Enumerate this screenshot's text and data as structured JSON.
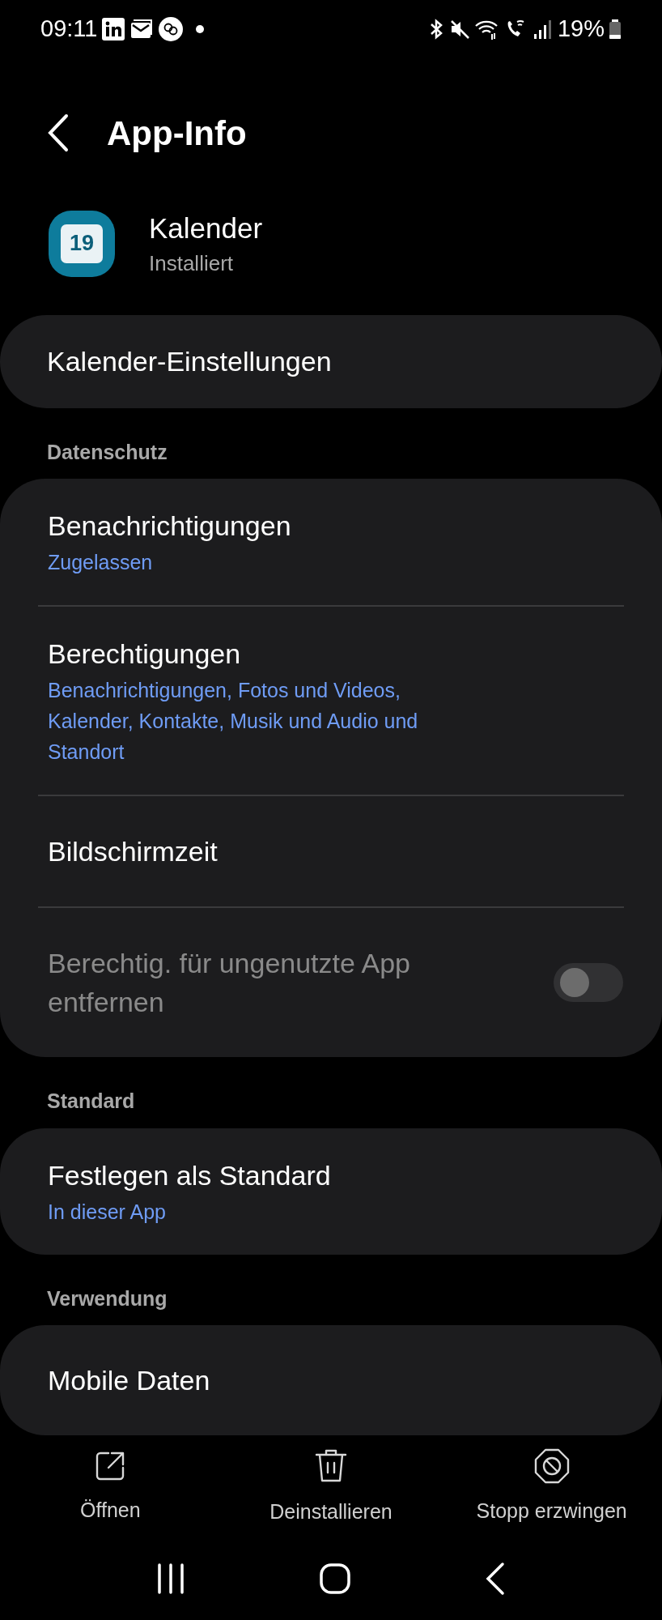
{
  "status_bar": {
    "time": "09:11",
    "battery": "19%"
  },
  "header": {
    "title": "App-Info"
  },
  "app": {
    "name": "Kalender",
    "icon_text": "19",
    "status": "Installiert"
  },
  "settings_link": {
    "label": "Kalender-Einstellungen"
  },
  "sections": [
    {
      "title": "Datenschutz",
      "items": [
        {
          "kind": "link",
          "label": "Benachrichtigungen",
          "summary": "Zugelassen",
          "disabled": false
        },
        {
          "kind": "link",
          "label": "Berechtigungen",
          "summary": "Benachrichtigungen, Fotos und Videos, Kalender, Kontakte, Musik und Audio und Standort",
          "disabled": false
        },
        {
          "kind": "link",
          "label": "Bildschirmzeit",
          "disabled": false
        },
        {
          "kind": "toggle",
          "label": "Berechtig. für ungenutzte App entfernen",
          "on": false,
          "disabled": true
        }
      ]
    },
    {
      "title": "Standard",
      "items": [
        {
          "kind": "link",
          "label": "Festlegen als Standard",
          "summary": "In dieser App",
          "disabled": false
        }
      ]
    },
    {
      "title": "Verwendung",
      "items": [
        {
          "kind": "link",
          "label": "Mobile Daten",
          "disabled": false
        }
      ]
    }
  ],
  "actions": [
    {
      "kind": "open",
      "label": "Öffnen"
    },
    {
      "kind": "uninstall",
      "label": "Deinstallieren"
    },
    {
      "kind": "force_stop",
      "label": "Stopp erzwingen"
    }
  ]
}
